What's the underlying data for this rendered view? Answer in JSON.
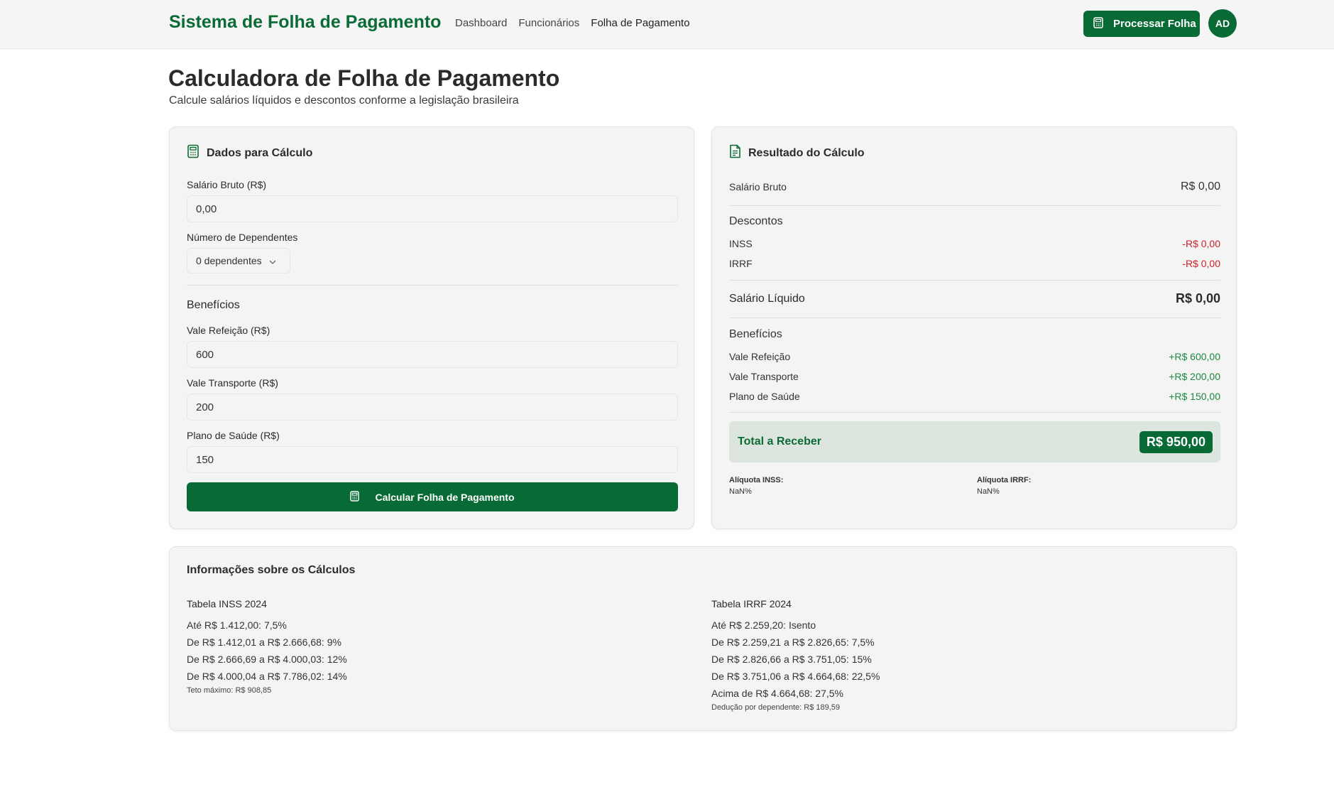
{
  "header": {
    "brand": "Sistema de Folha de Pagamento",
    "nav": [
      "Dashboard",
      "Funcionários",
      "Folha de Pagamento"
    ],
    "process_button": "Processar Folha",
    "avatar_initials": "AD"
  },
  "page": {
    "title": "Calculadora de Folha de Pagamento",
    "subtitle": "Calcule salários líquidos e descontos conforme a legislação brasileira"
  },
  "input_card": {
    "title": "Dados para Cálculo",
    "salary_label": "Salário Bruto (R$)",
    "salary_value": "0,00",
    "dependents_label": "Número de Dependentes",
    "dependents_value": "0 dependentes",
    "benefits_title": "Benefícios",
    "meal_label": "Vale Refeição (R$)",
    "meal_value": "600",
    "transport_label": "Vale Transporte (R$)",
    "transport_value": "200",
    "health_label": "Plano de Saúde (R$)",
    "health_value": "150",
    "calc_button": "Calcular Folha de Pagamento"
  },
  "result_card": {
    "title": "Resultado do Cálculo",
    "gross_label": "Salário Bruto",
    "gross_value": "R$ 0,00",
    "deductions_title": "Descontos",
    "inss_label": "INSS",
    "inss_value": "-R$ 0,00",
    "irrf_label": "IRRF",
    "irrf_value": "-R$ 0,00",
    "net_label": "Salário Líquido",
    "net_value": "R$ 0,00",
    "benefits_title": "Benefícios",
    "meal_label": "Vale Refeição",
    "meal_value": "+R$ 600,00",
    "transport_label": "Vale Transporte",
    "transport_value": "+R$ 200,00",
    "health_label": "Plano de Saúde",
    "health_value": "+R$ 150,00",
    "total_label": "Total a Receber",
    "total_value": "R$ 950,00",
    "inss_rate_label": "Alíquota INSS:",
    "inss_rate_value": "NaN%",
    "irrf_rate_label": "Alíquota IRRF:",
    "irrf_rate_value": "NaN%"
  },
  "info_card": {
    "title": "Informações sobre os Cálculos",
    "inss": {
      "title": "Tabela INSS 2024",
      "lines": [
        "Até R$ 1.412,00: 7,5%",
        "De R$ 1.412,01 a R$ 2.666,68: 9%",
        "De R$ 2.666,69 a R$ 4.000,03: 12%",
        "De R$ 4.000,04 a R$ 7.786,02: 14%"
      ],
      "note": "Teto máximo: R$ 908,85"
    },
    "irrf": {
      "title": "Tabela IRRF 2024",
      "lines": [
        "Até R$ 2.259,20: Isento",
        "De R$ 2.259,21 a R$ 2.826,65: 7,5%",
        "De R$ 2.826,66 a R$ 3.751,05: 15%",
        "De R$ 3.751,06 a R$ 4.664,68: 22,5%",
        "Acima de R$ 4.664,68: 27,5%"
      ],
      "note": "Dedução por dependente: R$ 189,59"
    }
  },
  "colors": {
    "brand_green": "#086a35",
    "negative_red": "#d0212c",
    "positive_green": "#1b8a3e"
  }
}
